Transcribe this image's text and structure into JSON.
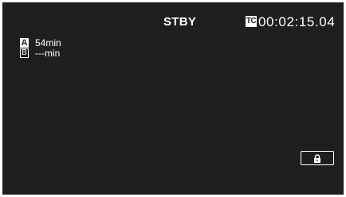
{
  "status": {
    "label": "STBY"
  },
  "timecode": {
    "badge": "TC",
    "value": "00:02:15.04"
  },
  "media": [
    {
      "slot": "A",
      "remaining": "54min",
      "style": "filled"
    },
    {
      "slot": "B",
      "remaining": "---min",
      "style": "outlined"
    }
  ],
  "controls": {
    "lock_icon": "lock-icon"
  },
  "colors": {
    "background": "#1f1f1f",
    "foreground": "#ffffff"
  }
}
